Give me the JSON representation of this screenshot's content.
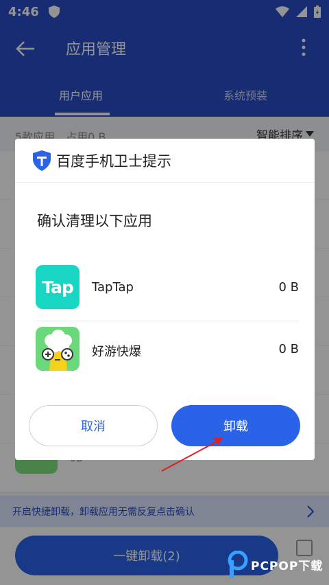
{
  "status_bar": {
    "time": "4:46"
  },
  "header": {
    "title": "应用管理"
  },
  "tabs": [
    {
      "label": "用户应用",
      "active": true
    },
    {
      "label": "系统预装",
      "active": false
    }
  ],
  "summary": {
    "text": "5款应用，占用0 B",
    "sort_label": "智能排序"
  },
  "background_list": {
    "size_text": "0B"
  },
  "tip_bar": {
    "text": "开启快捷卸载，卸载应用无需反复点击确认"
  },
  "bottom": {
    "bulk_uninstall_label": "一键卸载(2)"
  },
  "watermark": {
    "text": "PCPOP下载"
  },
  "dialog": {
    "title": "百度手机卫士提示",
    "confirm_text": "确认清理以下应用",
    "apps": [
      {
        "name": "TapTap",
        "size": "0 B",
        "icon_text": "Tap",
        "icon": "taptap-icon"
      },
      {
        "name": "好游快爆",
        "size": "0 B",
        "icon": "haoyoukuaibao-icon"
      }
    ],
    "cancel_label": "取消",
    "uninstall_label": "卸载"
  },
  "colors": {
    "primary_blue": "#2a4cc9",
    "button_blue": "#2a62e8",
    "taptap_teal": "#18d6c2",
    "haoyou_green": "#6ad87b",
    "annotation_red": "#e02020"
  }
}
